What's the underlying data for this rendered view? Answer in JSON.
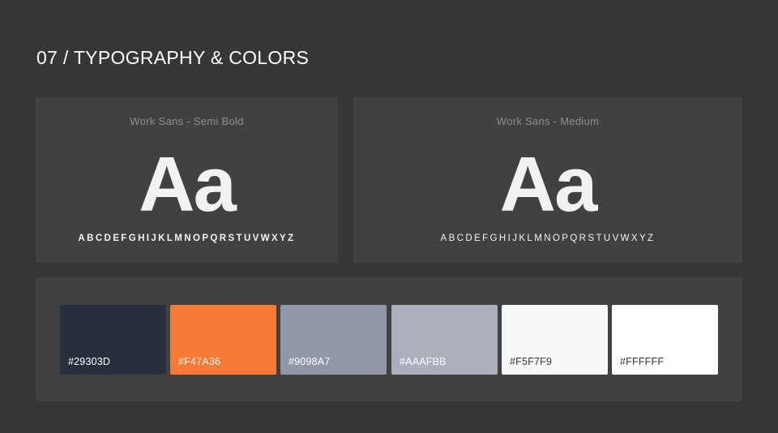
{
  "title": "07 / TYPOGRAPHY & COLORS",
  "fonts": [
    {
      "name": "Work Sans - Semi Bold",
      "sample": "Aa",
      "alphabet": "ABCDEFGHIJKLMNOPQRSTUVWXYZ"
    },
    {
      "name": "Work Sans - Medium",
      "sample": "Aa",
      "alphabet": "ABCDEFGHIJKLMNOPQRSTUVWXYZ"
    }
  ],
  "colors": [
    {
      "label": "#29303D",
      "hex": "#29303D",
      "text_color": "#FFFFFF"
    },
    {
      "label": "#F47A36",
      "hex": "#F47A36",
      "text_color": "#FFFFFF"
    },
    {
      "label": "#9098A7",
      "hex": "#9098A7",
      "text_color": "#FFFFFF"
    },
    {
      "label": "#AAAFBB",
      "hex": "#AAAFBB",
      "text_color": "#FFFFFF"
    },
    {
      "label": "#F5F7F9",
      "hex": "#F5F7F9",
      "text_color": "#3A3A3A"
    },
    {
      "label": "#FFFFFF",
      "hex": "#FFFFFF",
      "text_color": "#3A3A3A"
    }
  ]
}
